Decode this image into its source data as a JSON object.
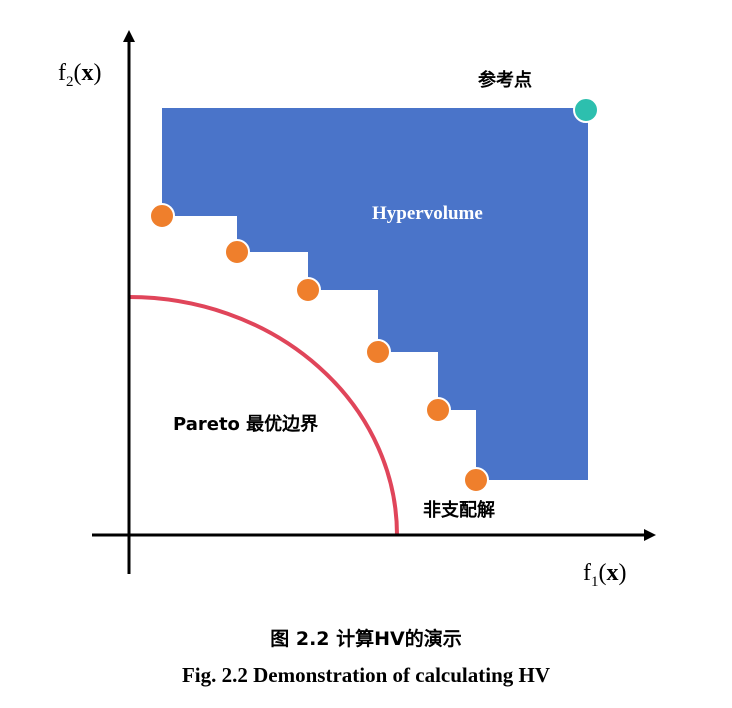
{
  "axes": {
    "y_label_main": "f",
    "y_label_sub": "2",
    "y_label_open": "(",
    "y_label_var": "x",
    "y_label_close": ")",
    "x_label_main": "f",
    "x_label_sub": "1",
    "x_label_open": "(",
    "x_label_var": "x",
    "x_label_close": ")"
  },
  "labels": {
    "reference_point": "参考点",
    "hypervolume": "Hypervolume",
    "pareto_front": "Pareto 最优边界",
    "non_dominated": "非支配解"
  },
  "caption": {
    "cn": "图 2.2  计算HV的演示",
    "en": "Fig. 2.2  Demonstration of calculating HV"
  },
  "colors": {
    "hypervolume_fill": "#4a74c9",
    "solution_point": "#ef7f2c",
    "reference_point": "#2dbfae",
    "pareto_curve": "#e0455a",
    "axis": "#000000"
  }
}
